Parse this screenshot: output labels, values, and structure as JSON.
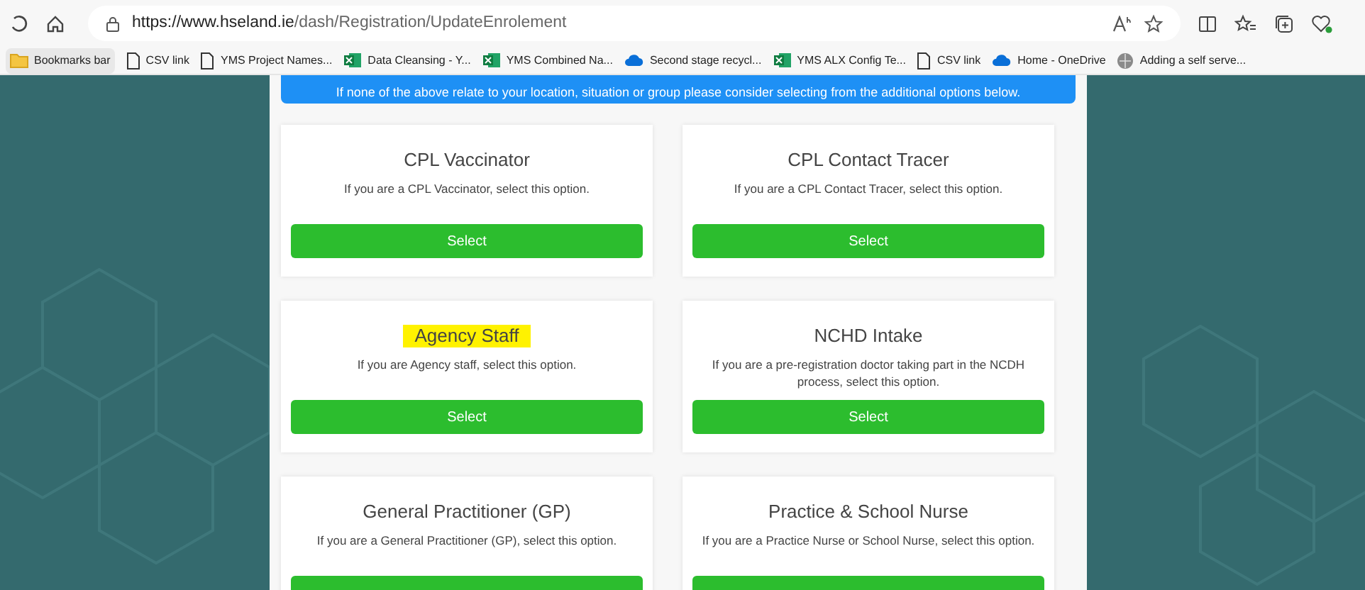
{
  "browser": {
    "url_host": "https://www.hseland.ie",
    "url_path": "/dash/Registration/UpdateEnrolement"
  },
  "bookmarks": [
    {
      "label": "Bookmarks bar",
      "kind": "folder"
    },
    {
      "label": "CSV link",
      "kind": "page"
    },
    {
      "label": "YMS Project Names...",
      "kind": "page"
    },
    {
      "label": "Data Cleansing - Y...",
      "kind": "excel"
    },
    {
      "label": "YMS Combined Na...",
      "kind": "excel"
    },
    {
      "label": "Second stage recycl...",
      "kind": "cloud"
    },
    {
      "label": "YMS ALX Config Te...",
      "kind": "excel"
    },
    {
      "label": "CSV link",
      "kind": "page"
    },
    {
      "label": "Home - OneDrive",
      "kind": "cloud"
    },
    {
      "label": "Adding a self serve...",
      "kind": "globe"
    }
  ],
  "banner": "If none of the above relate to your location, situation or group please consider selecting from the additional options below.",
  "cards": [
    {
      "title": "CPL Vaccinator",
      "description": "If you are a CPL Vaccinator, select this option.",
      "button": "Select",
      "highlighted": false
    },
    {
      "title": "CPL Contact Tracer",
      "description": "If you are a CPL Contact Tracer, select this option.",
      "button": "Select",
      "highlighted": false
    },
    {
      "title": "Agency Staff",
      "description": "If you are Agency staff, select this option.",
      "button": "Select",
      "highlighted": true
    },
    {
      "title": "NCHD Intake",
      "description": "If you are a pre-registration doctor taking part in the NCDH process, select this option.",
      "button": "Select",
      "highlighted": false
    },
    {
      "title": "General Practitioner (GP)",
      "description": "If you are a General Practitioner (GP), select this option.",
      "highlighted": false
    },
    {
      "title": "Practice & School Nurse",
      "description": "If you are a Practice Nurse or School Nurse, select this option.",
      "highlighted": false
    }
  ]
}
